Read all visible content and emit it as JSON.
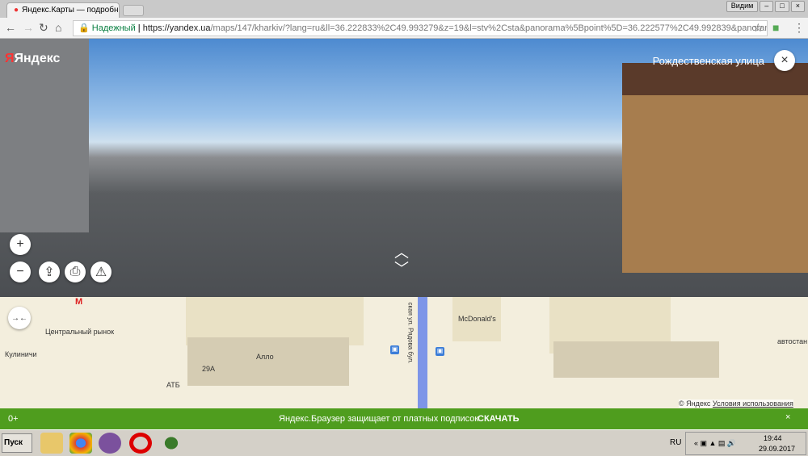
{
  "browser": {
    "tab_title": "Яндекс.Карты — подробн",
    "window_btn": "Видим",
    "secure_label": "Надежный",
    "url_host": "https://yandex.ua",
    "url_rest": "/maps/147/kharkiv/?lang=ru&ll=36.222833%2C49.993279&z=19&l=stv%2Csta&panorama%5Bpoint%5D=36.222577%2C49.992839&panorama..."
  },
  "panorama": {
    "logo": "Яндекс",
    "street_name": "Рождественская улица"
  },
  "map": {
    "labels": {
      "metro": "Центральный рынок",
      "cafe": "Кулиничи",
      "shop": "АТБ",
      "allo": "Алло",
      "building": "29А",
      "mcdonalds": "McDonald's",
      "street": "ская ул. Рядова бул.",
      "bus_station": "автостан"
    },
    "copyright": "© Яндекс",
    "terms": "Условия использования"
  },
  "banner": {
    "age": "0+",
    "text": "Яндекс.Браузер защищает от платных подписок",
    "action": "СКАЧАТЬ"
  },
  "taskbar": {
    "start": "Пуск",
    "lang": "RU",
    "time": "19:44",
    "date": "29.09.2017"
  }
}
